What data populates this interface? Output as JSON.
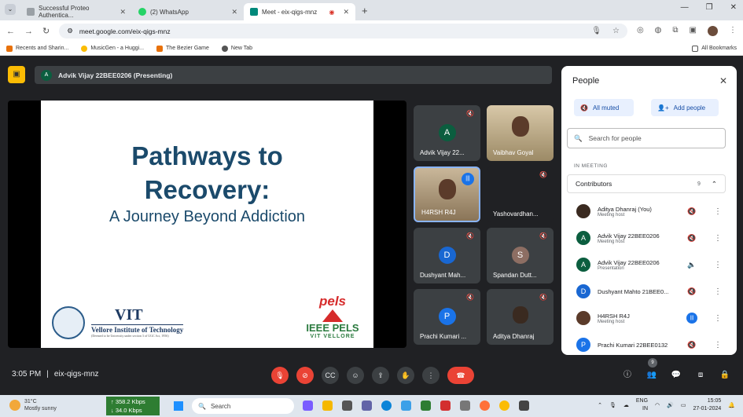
{
  "browser": {
    "tabs": [
      {
        "title": "Successful Proteo Authentica...",
        "color": "#9aa0a6",
        "active": false
      },
      {
        "title": "(2) WhatsApp",
        "color": "#25d366",
        "active": false
      },
      {
        "title": "Meet - eix-qigs-mnz",
        "color": "#00897b",
        "active": true
      }
    ],
    "url": "meet.google.com/eix-qigs-mnz",
    "bookmarks": [
      {
        "label": "Recents and Sharin...",
        "color": "#e8710a"
      },
      {
        "label": "MusicGen - a Huggi...",
        "color": "#fbbc04"
      },
      {
        "label": "The Bezier Game",
        "color": "#e8710a"
      },
      {
        "label": "New Tab",
        "color": "#555555"
      }
    ],
    "all_bookmarks": "All Bookmarks"
  },
  "meet": {
    "presenting_initial": "A",
    "presenting_label": "Advik Vijay 22BEE0206 (Presenting)",
    "slide": {
      "title_line1": "Pathways to",
      "title_line2": "Recovery:",
      "subtitle": "A Journey Beyond Addiction",
      "vit_big": "VIT",
      "vit_name": "Vellore Institute of Technology",
      "vit_tag": "(Deemed to be University under section 3 of UGC Act, 1956)",
      "pels_top": "pels",
      "pels_name": "IEEE PELS",
      "pels_sub": "VIT VELLORE"
    },
    "tiles": [
      {
        "name": "Advik Vijay 22...",
        "initial": "A",
        "color": "#0b5e3f",
        "video": false
      },
      {
        "name": "Vaibhav Goyal",
        "initial": "",
        "color": "",
        "video": true
      },
      {
        "name": "H4RSH R4J",
        "initial": "",
        "color": "",
        "video": true
      },
      {
        "name": "Yashovardhan...",
        "initial": "",
        "color": "",
        "video": false
      },
      {
        "name": "Dushyant Mah...",
        "initial": "D",
        "color": "#1967d2",
        "video": false
      },
      {
        "name": "Spandan Dutt...",
        "initial": "S",
        "color": "#8d6e63",
        "video": false
      },
      {
        "name": "Prachi Kumari ...",
        "initial": "P",
        "color": "#1a73e8",
        "video": false
      },
      {
        "name": "Aditya Dhanraj",
        "initial": "",
        "color": "",
        "video": true
      }
    ],
    "time": "3:05 PM",
    "separator": "|",
    "code": "eix-qigs-mnz",
    "people_badge": "9"
  },
  "people": {
    "title": "People",
    "all_muted": "All muted",
    "add_people": "Add people",
    "search_placeholder": "Search for people",
    "in_meeting": "IN MEETING",
    "contributors": "Contributors",
    "contributors_count": "9",
    "rows": [
      {
        "name": "Aditya Dhanraj (You)",
        "role": "Meeting host",
        "initial": "",
        "color": "#3a2a20"
      },
      {
        "name": "Advik Vijay 22BEE0206",
        "role": "Meeting host",
        "initial": "A",
        "color": "#0b5e3f"
      },
      {
        "name": "Advik Vijay 22BEE0206",
        "role": "Presentation",
        "initial": "A",
        "color": "#0b5e3f"
      },
      {
        "name": "Dushyant Mahto 21BEE0...",
        "role": "",
        "initial": "D",
        "color": "#1967d2"
      },
      {
        "name": "H4RSH R4J",
        "role": "Meeting host",
        "initial": "",
        "color": "#5b3b2a"
      },
      {
        "name": "Prachi Kumari 22BEE0132",
        "role": "",
        "initial": "P",
        "color": "#1a73e8"
      }
    ]
  },
  "taskbar": {
    "temp": "31°C",
    "weather": "Mostly sunny",
    "net_up": "↑ 358.2 Kbps",
    "net_down": "↓ 34.0 Kbps",
    "search": "Search",
    "lang1": "ENG",
    "lang2": "IN",
    "time": "15:05",
    "date": "27-01-2024"
  }
}
